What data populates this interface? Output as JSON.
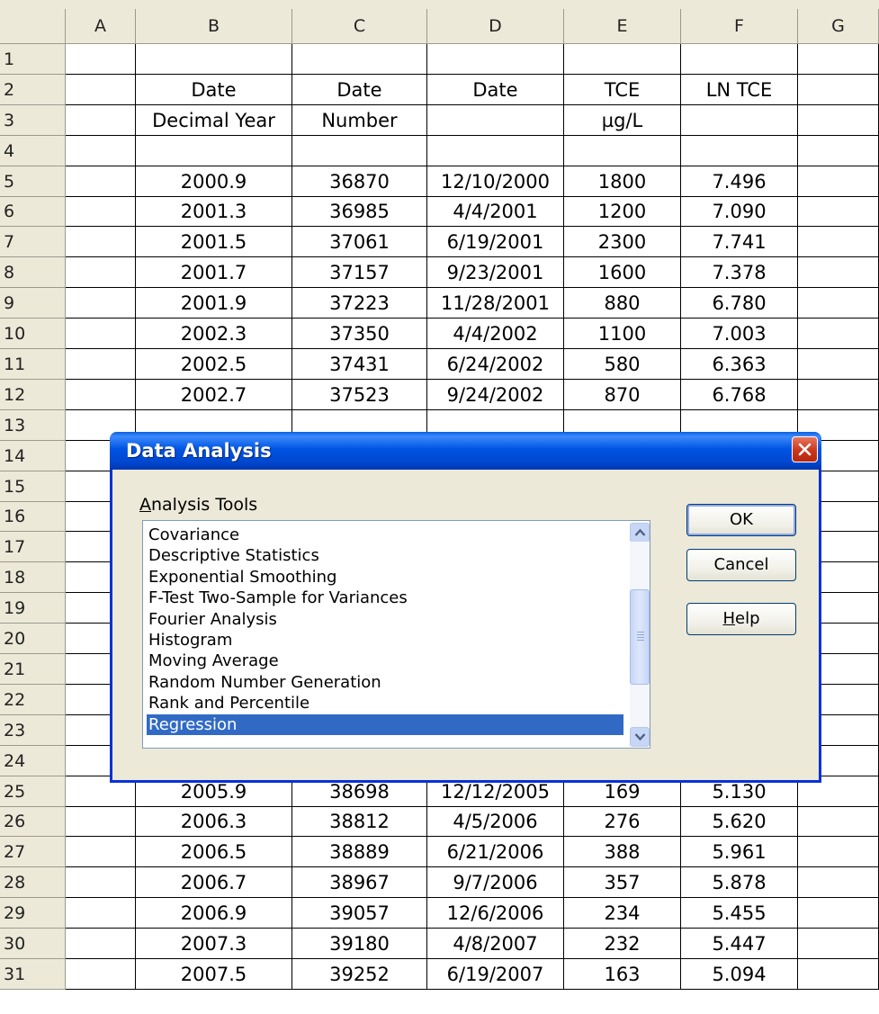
{
  "sheet": {
    "columns": [
      "A",
      "B",
      "C",
      "D",
      "E",
      "F",
      "G"
    ],
    "rows": [
      {
        "n": "1",
        "b": "",
        "c": "",
        "d": "",
        "e": "",
        "f": ""
      },
      {
        "n": "2",
        "b": "Date",
        "c": "Date",
        "d": "Date",
        "e": "TCE",
        "f": "LN TCE"
      },
      {
        "n": "3",
        "b": "Decimal Year",
        "c": "Number",
        "d": "",
        "e": "µg/L",
        "f": ""
      },
      {
        "n": "4",
        "b": "",
        "c": "",
        "d": "",
        "e": "",
        "f": ""
      },
      {
        "n": "5",
        "b": "2000.9",
        "c": "36870",
        "d": "12/10/2000",
        "e": "1800",
        "f": "7.496"
      },
      {
        "n": "6",
        "b": "2001.3",
        "c": "36985",
        "d": "4/4/2001",
        "e": "1200",
        "f": "7.090"
      },
      {
        "n": "7",
        "b": "2001.5",
        "c": "37061",
        "d": "6/19/2001",
        "e": "2300",
        "f": "7.741"
      },
      {
        "n": "8",
        "b": "2001.7",
        "c": "37157",
        "d": "9/23/2001",
        "e": "1600",
        "f": "7.378"
      },
      {
        "n": "9",
        "b": "2001.9",
        "c": "37223",
        "d": "11/28/2001",
        "e": "880",
        "f": "6.780"
      },
      {
        "n": "10",
        "b": "2002.3",
        "c": "37350",
        "d": "4/4/2002",
        "e": "1100",
        "f": "7.003"
      },
      {
        "n": "11",
        "b": "2002.5",
        "c": "37431",
        "d": "6/24/2002",
        "e": "580",
        "f": "6.363"
      },
      {
        "n": "12",
        "b": "2002.7",
        "c": "37523",
        "d": "9/24/2002",
        "e": "870",
        "f": "6.768"
      },
      {
        "n": "13",
        "b": "",
        "c": "",
        "d": "",
        "e": "",
        "f": ""
      },
      {
        "n": "14",
        "b": "",
        "c": "",
        "d": "",
        "e": "",
        "f": ""
      },
      {
        "n": "15",
        "b": "",
        "c": "",
        "d": "",
        "e": "",
        "f": ""
      },
      {
        "n": "16",
        "b": "",
        "c": "",
        "d": "",
        "e": "",
        "f": ""
      },
      {
        "n": "17",
        "b": "",
        "c": "",
        "d": "",
        "e": "",
        "f": ""
      },
      {
        "n": "18",
        "b": "",
        "c": "",
        "d": "",
        "e": "",
        "f": ""
      },
      {
        "n": "19",
        "b": "",
        "c": "",
        "d": "",
        "e": "",
        "f": ""
      },
      {
        "n": "20",
        "b": "",
        "c": "",
        "d": "",
        "e": "",
        "f": ""
      },
      {
        "n": "21",
        "b": "",
        "c": "",
        "d": "",
        "e": "",
        "f": ""
      },
      {
        "n": "22",
        "b": "",
        "c": "",
        "d": "",
        "e": "",
        "f": ""
      },
      {
        "n": "23",
        "b": "",
        "c": "",
        "d": "",
        "e": "",
        "f": ""
      },
      {
        "n": "24",
        "b": "",
        "c": "",
        "d": "",
        "e": "",
        "f": ""
      },
      {
        "n": "25",
        "b": "2005.9",
        "c": "38698",
        "d": "12/12/2005",
        "e": "169",
        "f": "5.130"
      },
      {
        "n": "26",
        "b": "2006.3",
        "c": "38812",
        "d": "4/5/2006",
        "e": "276",
        "f": "5.620"
      },
      {
        "n": "27",
        "b": "2006.5",
        "c": "38889",
        "d": "6/21/2006",
        "e": "388",
        "f": "5.961"
      },
      {
        "n": "28",
        "b": "2006.7",
        "c": "38967",
        "d": "9/7/2006",
        "e": "357",
        "f": "5.878"
      },
      {
        "n": "29",
        "b": "2006.9",
        "c": "39057",
        "d": "12/6/2006",
        "e": "234",
        "f": "5.455"
      },
      {
        "n": "30",
        "b": "2007.3",
        "c": "39180",
        "d": "4/8/2007",
        "e": "232",
        "f": "5.447"
      },
      {
        "n": "31",
        "b": "2007.5",
        "c": "39252",
        "d": "6/19/2007",
        "e": "163",
        "f": "5.094"
      }
    ]
  },
  "dialog": {
    "title": "Data Analysis",
    "close_icon": "close-icon",
    "list_label": "Analysis Tools",
    "list_label_accel": "A",
    "list_label_rest": "nalysis Tools",
    "items": [
      "Covariance",
      "Descriptive Statistics",
      "Exponential Smoothing",
      "F-Test Two-Sample for Variances",
      "Fourier Analysis",
      "Histogram",
      "Moving Average",
      "Random Number Generation",
      "Rank and Percentile",
      "Regression"
    ],
    "selected_item": "Regression",
    "ok_label": "OK",
    "cancel_label": "Cancel",
    "help_label": "Help",
    "help_accel": "H",
    "help_rest": "elp",
    "colors": {
      "title_bar": "#0054e3",
      "selection": "#316ac5",
      "close_button": "#c9361c"
    }
  }
}
